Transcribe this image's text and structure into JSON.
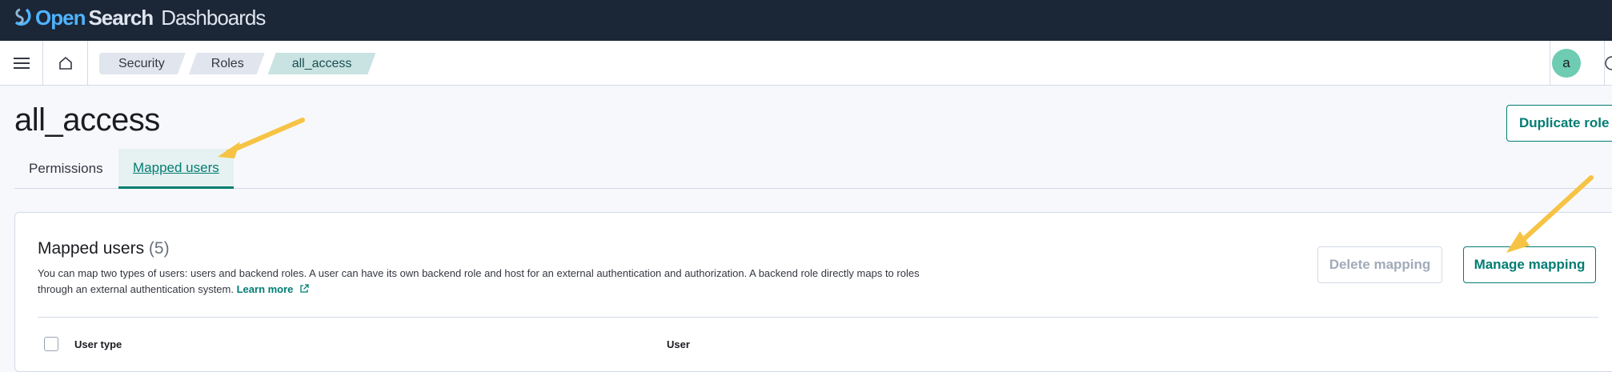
{
  "brand": {
    "open": "Open",
    "search": "Search",
    "dashboards": "Dashboards"
  },
  "breadcrumbs": [
    "Security",
    "Roles",
    "all_access"
  ],
  "user": {
    "avatar_initial": "a"
  },
  "page": {
    "title": "all_access",
    "duplicate_label": "Duplicate role"
  },
  "tabs": [
    {
      "label": "Permissions",
      "selected": false
    },
    {
      "label": "Mapped users",
      "selected": true
    }
  ],
  "panel": {
    "title": "Mapped users",
    "count": "(5)",
    "description": "You can map two types of users: users and backend roles. A user can have its own backend role and host for an external authentication and authorization. A backend role directly maps to roles through an external authentication system.",
    "learn_more": "Learn more",
    "delete_label": "Delete mapping",
    "manage_label": "Manage mapping",
    "columns": [
      "User type",
      "User"
    ]
  },
  "colors": {
    "accent": "#017d73",
    "header_bg": "#1b2636",
    "annotation": "#f6c344"
  }
}
